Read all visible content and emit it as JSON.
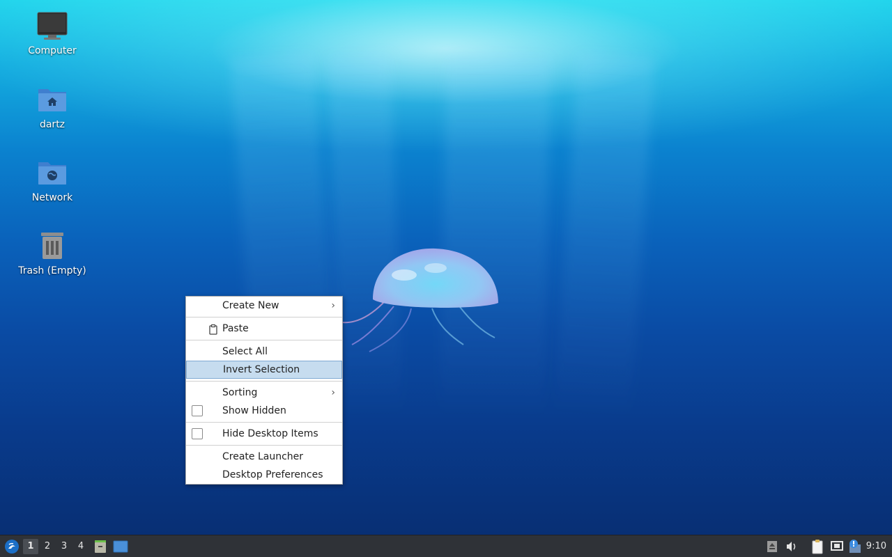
{
  "desktop": {
    "icons": [
      {
        "label": "Computer",
        "icon": "computer-icon"
      },
      {
        "label": "dartz",
        "icon": "home-folder-icon"
      },
      {
        "label": "Network",
        "icon": "network-folder-icon"
      },
      {
        "label": "Trash (Empty)",
        "icon": "trash-icon"
      }
    ]
  },
  "context_menu": {
    "items": {
      "create_new": "Create New",
      "paste": "Paste",
      "select_all": "Select All",
      "invert_selection": "Invert Selection",
      "sorting": "Sorting",
      "show_hidden": "Show Hidden",
      "hide_desktop_items": "Hide Desktop Items",
      "create_launcher": "Create Launcher",
      "desktop_preferences": "Desktop Preferences"
    },
    "submenu_arrow": "›",
    "highlighted": "Invert Selection"
  },
  "taskbar": {
    "workspaces": [
      "1",
      "2",
      "3",
      "4"
    ],
    "active_workspace": "1",
    "clock": "9:10"
  },
  "colors": {
    "menu_highlight": "#c6dcef",
    "taskbar_bg": "#2f3237",
    "folder_blue": "#5b9be0"
  }
}
